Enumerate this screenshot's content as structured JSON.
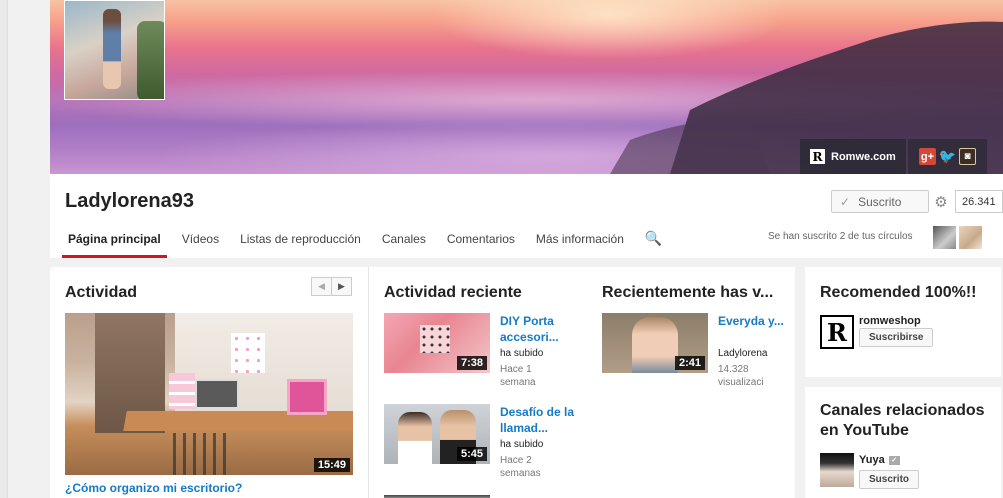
{
  "channel": {
    "name": "Ladylorena93",
    "subscribe_label": "Suscrito",
    "subscriber_count": "26.341",
    "circles_note": "Se han suscrito 2 de tus círculos"
  },
  "banner_links": {
    "site_label": "Romwe.com",
    "site_icon": "R",
    "social": [
      {
        "name": "gplus",
        "glyph": "g+"
      },
      {
        "name": "twitter",
        "glyph": "🐦"
      },
      {
        "name": "instagram",
        "glyph": "◙"
      }
    ]
  },
  "tabs": [
    {
      "label": "Página principal",
      "active": true
    },
    {
      "label": "Vídeos",
      "active": false
    },
    {
      "label": "Listas de reproducción",
      "active": false
    },
    {
      "label": "Canales",
      "active": false
    },
    {
      "label": "Comentarios",
      "active": false
    },
    {
      "label": "Más información",
      "active": false
    }
  ],
  "activity": {
    "title": "Actividad",
    "pager_prev": "◀",
    "pager_next": "▶",
    "feature": {
      "title": "¿Cómo organizo mi escritorio?",
      "duration": "15:49"
    }
  },
  "recent_activity": {
    "title": "Actividad reciente",
    "videos": [
      {
        "title": "DIY Porta accesori...",
        "action": "ha subido",
        "when": "Hace 1 semana",
        "duration": "7:38"
      },
      {
        "title": "Desafío de la llamad...",
        "action": "ha subido",
        "when": "Hace 2 semanas",
        "duration": "5:45"
      }
    ]
  },
  "recently_watched": {
    "title": "Recientemente has v...",
    "videos": [
      {
        "title": "Everyda y...",
        "author": "Ladylorena",
        "views": "14.328 visualizaci",
        "duration": "2:41"
      }
    ]
  },
  "recommended": {
    "title": "Recomended 100%!!",
    "channel": {
      "name": "romweshop",
      "avatar_letter": "R",
      "button": "Suscribirse"
    }
  },
  "related": {
    "title": "Canales relacionados en YouTube",
    "channel": {
      "name": "Yuya",
      "verified_glyph": "✓",
      "button": "Suscrito"
    }
  },
  "icons": {
    "search": "🔍",
    "gear": "⚙",
    "check": "✓"
  }
}
